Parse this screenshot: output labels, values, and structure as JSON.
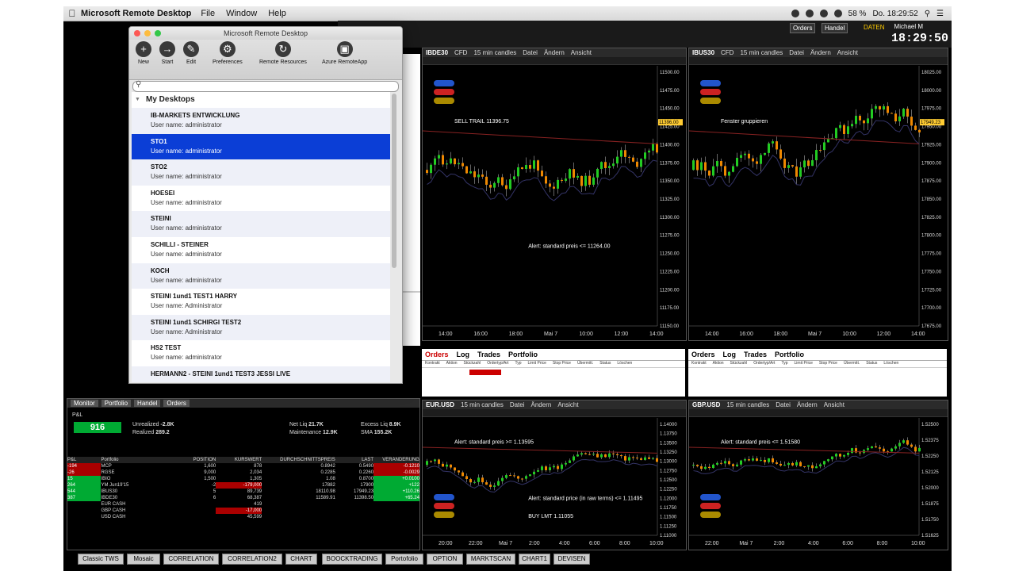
{
  "menubar": {
    "app": "Microsoft Remote Desktop",
    "items": [
      "File",
      "Window",
      "Help"
    ],
    "battery": "58 %",
    "datetime": "Do. 18:29:52"
  },
  "tws": {
    "clock": "18:29:50",
    "user": "Michael M",
    "orders_btn": "Orders",
    "handel_btn": "Handel",
    "daten": "DATEN"
  },
  "rdp": {
    "title": "Microsoft Remote Desktop",
    "toolbar": [
      {
        "icon": "plus-icon",
        "label": "New"
      },
      {
        "icon": "start-icon",
        "label": "Start"
      },
      {
        "icon": "edit-icon",
        "label": "Edit"
      },
      {
        "icon": "gear-icon",
        "label": "Preferences"
      },
      {
        "icon": "remote-resources-icon",
        "label": "Remote Resources"
      },
      {
        "icon": "azure-icon",
        "label": "Azure RemoteApp"
      }
    ],
    "group": "My Desktops",
    "desktops": [
      {
        "name": "IB-MARKETS ENTWICKLUNG",
        "user": "User name: administrator"
      },
      {
        "name": "STO1",
        "user": "User name: administrator"
      },
      {
        "name": "STO2",
        "user": "User name: administrator"
      },
      {
        "name": "HOESEI",
        "user": "User name: administrator"
      },
      {
        "name": "STEINI",
        "user": "User name: administrator"
      },
      {
        "name": "SCHILLI - STEINER",
        "user": "User name: administrator"
      },
      {
        "name": "KOCH",
        "user": "User name: administrator"
      },
      {
        "name": "STEINI 1und1 TEST1 HARRY",
        "user": "User name: Administrator"
      },
      {
        "name": "STEINI 1und1 SCHIRGI TEST2",
        "user": "User name: Administrator"
      },
      {
        "name": "HS2 TEST",
        "user": "User name: administrator"
      },
      {
        "name": "HERMANN2 - STEINI 1und1 TEST3 JESSI LIVE",
        "user": ""
      }
    ]
  },
  "charts": [
    {
      "symbol": "IBDE30",
      "kind": "CFD",
      "interval": "15 min candles",
      "menu": [
        "Datei",
        "Ändern",
        "Ansicht"
      ],
      "yticks": [
        "11500.00",
        "11475.00",
        "11450.00",
        "11425.00",
        "11400.00",
        "11375.00",
        "11350.00",
        "11325.00",
        "11300.00",
        "11275.00",
        "11250.00",
        "11225.00",
        "11200.00",
        "11175.00",
        "11150.00"
      ],
      "xticks": [
        "14:00",
        "16:00",
        "18:00",
        "Mai 7",
        "10:00",
        "12:00",
        "14:00"
      ],
      "note1": "SELL TRAIL 11396.75",
      "note2": "Alert: standard preis <= 11264.00",
      "price": "11396.00"
    },
    {
      "symbol": "IBUS30",
      "kind": "CFD",
      "interval": "15 min candles",
      "menu": [
        "Datei",
        "Ändern",
        "Ansicht"
      ],
      "yticks": [
        "18025.00",
        "18000.00",
        "17975.00",
        "17950.00",
        "17925.00",
        "17900.00",
        "17875.00",
        "17850.00",
        "17825.00",
        "17800.00",
        "17775.00",
        "17750.00",
        "17725.00",
        "17700.00",
        "17675.00"
      ],
      "xticks": [
        "14:00",
        "16:00",
        "18:00",
        "Mai 7",
        "10:00",
        "12:00",
        "14:00"
      ],
      "note1": "Fenster gruppieren",
      "price": "17949.23"
    },
    {
      "symbol": "EUR.USD",
      "kind": "",
      "interval": "15 min candles",
      "menu": [
        "Datei",
        "Ändern",
        "Ansicht"
      ],
      "yticks": [
        "1.14000",
        "1.13750",
        "1.13500",
        "1.13250",
        "1.13000",
        "1.12750",
        "1.12500",
        "1.12250",
        "1.12000",
        "1.11750",
        "1.11500",
        "1.11250",
        "1.11000"
      ],
      "xticks": [
        "20:00",
        "22:00",
        "Mai 7",
        "2:00",
        "4:00",
        "6:00",
        "8:00",
        "10:00"
      ],
      "note1": "Alert: standard preis >= 1.13595",
      "note2": "Alert: standard price (in raw terms) <= 1.11495",
      "note3": "BUY LMT 1.11055"
    },
    {
      "symbol": "GBP.USD",
      "kind": "",
      "interval": "15 min candles",
      "menu": [
        "Datei",
        "Ändern",
        "Ansicht"
      ],
      "yticks": [
        "1.52500",
        "1.52375",
        "1.52250",
        "1.52125",
        "1.52000",
        "1.51875",
        "1.51750",
        "1.51625"
      ],
      "xticks": [
        "22:00",
        "Mai 7",
        "2:00",
        "4:00",
        "6:00",
        "8:00",
        "10:00"
      ],
      "note1": "Alert: standard preis <= 1.51580"
    }
  ],
  "orders": {
    "tabs": [
      "Orders",
      "Log",
      "Trades",
      "Portfolio"
    ],
    "cols": [
      "Kontrakt",
      "Aktion",
      "Stückzahl",
      "Ordertyp/Art",
      "Typ",
      "Limit Price",
      "Stop Price",
      "Übermitt.",
      "Status",
      "Löschen"
    ]
  },
  "monitor": {
    "tabs": [
      "Monitor",
      "Portfolio",
      "Handel",
      "Orders"
    ],
    "pl": "916",
    "unrealized": "-2.8K",
    "realized": "289.2",
    "net_liq": "21.7K",
    "excess_liq": "8.9K",
    "maintenance": "12.9K",
    "sma": "155.2K",
    "headers": [
      "P&L",
      "Portfolio",
      "POSITION",
      "KURSWERT",
      "DURCHSCHNITTSPREIS",
      "LAST",
      "VERÄNDERUNG"
    ],
    "rows": [
      [
        "-194",
        "MCP",
        "1,600",
        "878",
        "0.8942",
        "0.5490",
        "-0.1210"
      ],
      [
        "-26",
        "RGSE",
        "9,000",
        "2,034",
        "0.2285",
        "0.2260",
        "-0.0029"
      ],
      [
        "15",
        "IBIO",
        "1,500",
        "1,305",
        "1.08",
        "0.8700",
        "+0.0100"
      ],
      [
        "264",
        "YM Jun19'15",
        "-2",
        "-179,000",
        "17882",
        "17900",
        "+122"
      ],
      [
        "544",
        "IBUS30",
        "5",
        "89,739",
        "18110.98",
        "17949.23",
        "+110.26"
      ],
      [
        "387",
        "IBDE30",
        "6",
        "68,387",
        "11589.91",
        "11398.50",
        "+65.24"
      ],
      [
        "",
        "EUR CASH",
        "",
        "419",
        "",
        "",
        ""
      ],
      [
        "",
        "GBP CASH",
        "",
        "-17,000",
        "",
        "",
        ""
      ],
      [
        "",
        "USD CASH",
        "",
        "45,599",
        "",
        "",
        ""
      ]
    ]
  },
  "taskbar": [
    "Classic TWS",
    "Mosaic",
    "CORRELATION",
    "CORRELATION2",
    "CHART",
    "BOOCKTRADING",
    "Portofolio",
    "OPTION",
    "MARKTSCAN",
    "CHART1",
    "DEVISEN"
  ]
}
